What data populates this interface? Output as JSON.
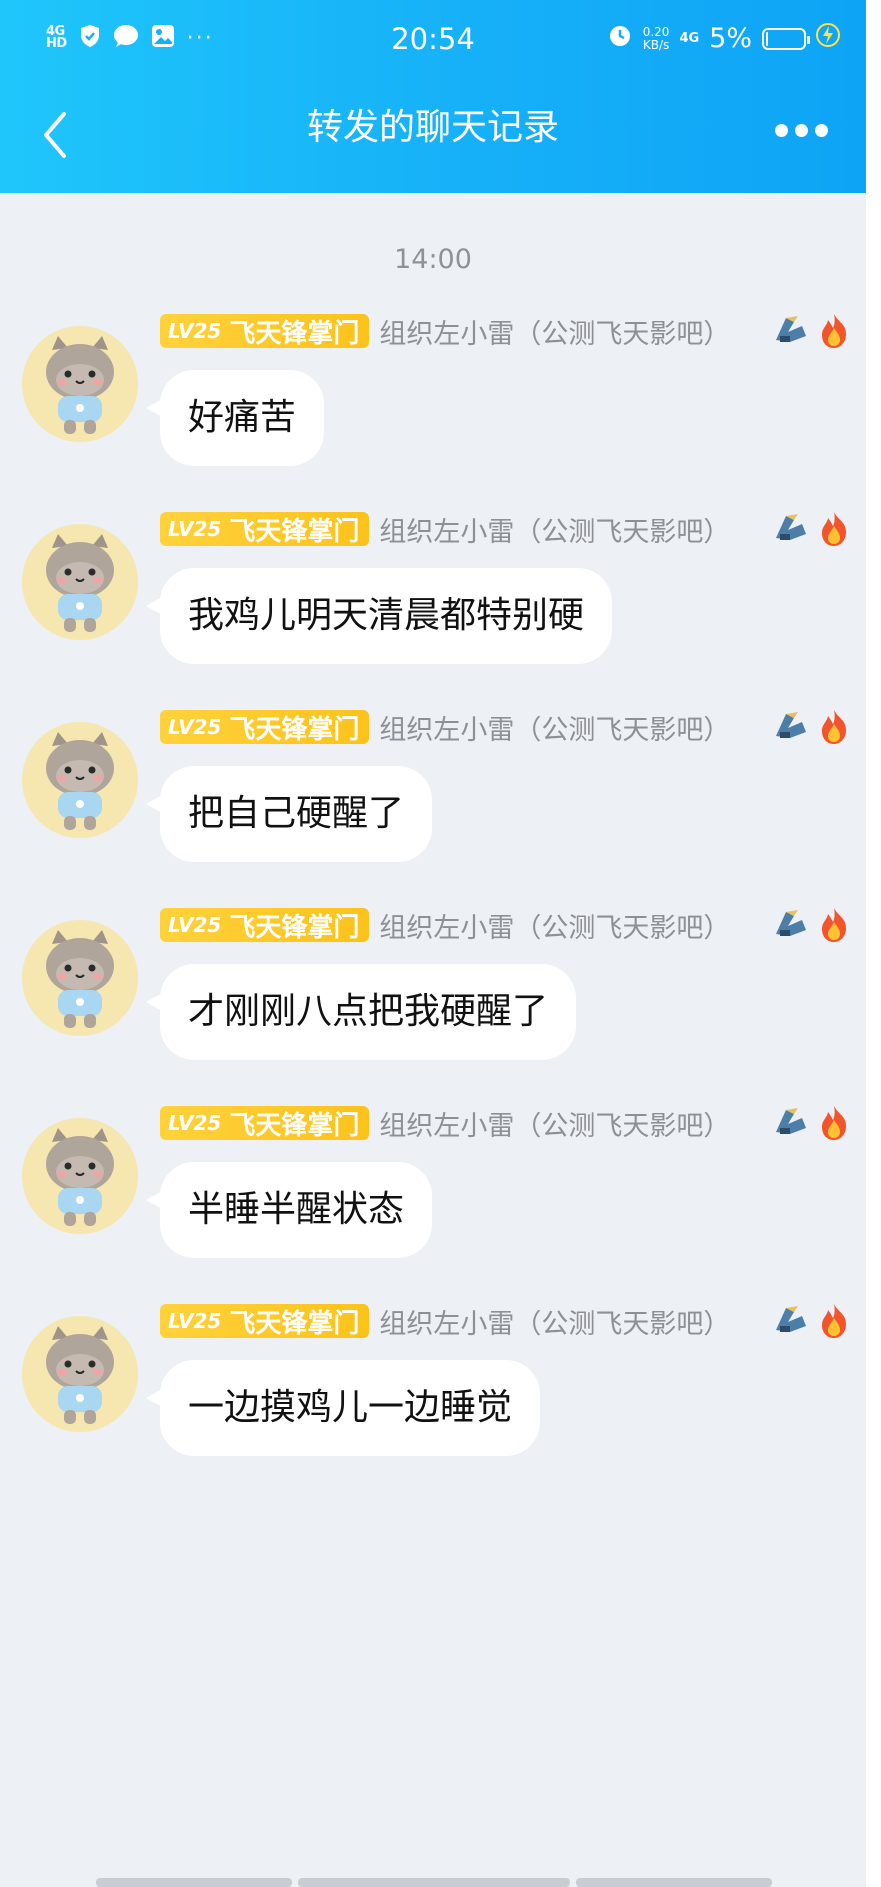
{
  "status_bar": {
    "network_top": "4G",
    "network_bottom": "HD",
    "time": "20:54",
    "speed_value": "0.20",
    "speed_unit": "KB/s",
    "mobile": "4G",
    "battery": "5%",
    "battery_level": 0.05
  },
  "nav": {
    "title": "转发的聊天记录"
  },
  "chat": {
    "timestamp": "14:00",
    "sender": {
      "level": "LV25",
      "title": "飞天锋掌门",
      "nickname": "组织左小雷（公测飞天影吧）"
    },
    "messages": [
      {
        "text": "好痛苦"
      },
      {
        "text": "我鸡儿明天清晨都特别硬"
      },
      {
        "text": "把自己硬醒了"
      },
      {
        "text": "才刚刚八点把我硬醒了"
      },
      {
        "text": "半睡半醒状态"
      },
      {
        "text": "一边摸鸡儿一边睡觉"
      }
    ]
  },
  "colors": {
    "header": "#16b0f8",
    "background": "#edf0f5",
    "badge": "#fbc21a"
  },
  "icons": [
    "back-icon",
    "more-icon",
    "shield-icon",
    "message-icon",
    "gallery-icon",
    "alarm-icon",
    "charging-icon",
    "mech-icon",
    "fire-icon"
  ]
}
